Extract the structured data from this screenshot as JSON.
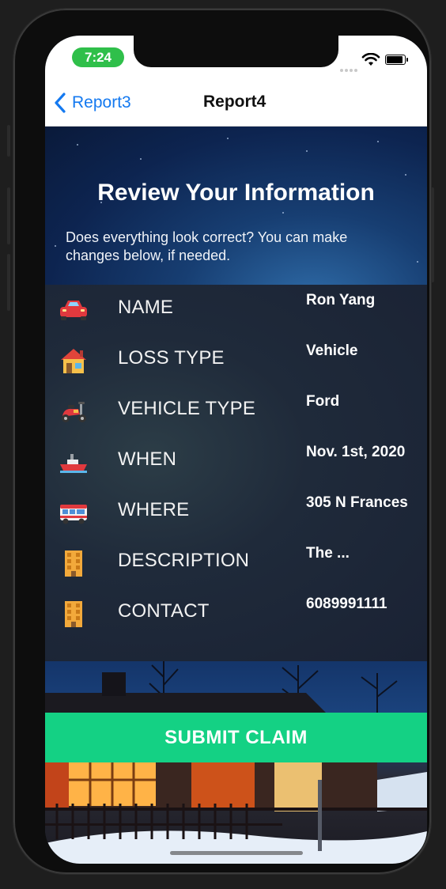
{
  "status_bar": {
    "time": "7:24"
  },
  "nav": {
    "back_label": "Report3",
    "title": "Report4"
  },
  "header": {
    "title": "Review Your Information",
    "subtitle": "Does everything look correct? You can make changes below, if needed."
  },
  "rows": [
    {
      "icon": "car-icon",
      "label": "NAME",
      "value": "Ron Yang"
    },
    {
      "icon": "house-icon",
      "label": "LOSS TYPE",
      "value": "Vehicle"
    },
    {
      "icon": "scooter-icon",
      "label": "VEHICLE TYPE",
      "value": "Ford"
    },
    {
      "icon": "ship-icon",
      "label": "WHEN",
      "value": "Nov. 1st, 2020"
    },
    {
      "icon": "bus-icon",
      "label": "WHERE",
      "value": "305 N Frances"
    },
    {
      "icon": "building-icon",
      "label": "DESCRIPTION",
      "value": "The ..."
    },
    {
      "icon": "building-icon",
      "label": "CONTACT",
      "value": "6089991111"
    }
  ],
  "submit_label": "SUBMIT CLAIM",
  "colors": {
    "accent": "#1479f0",
    "submit": "#14d184",
    "time_pill": "#2fbf4a"
  }
}
